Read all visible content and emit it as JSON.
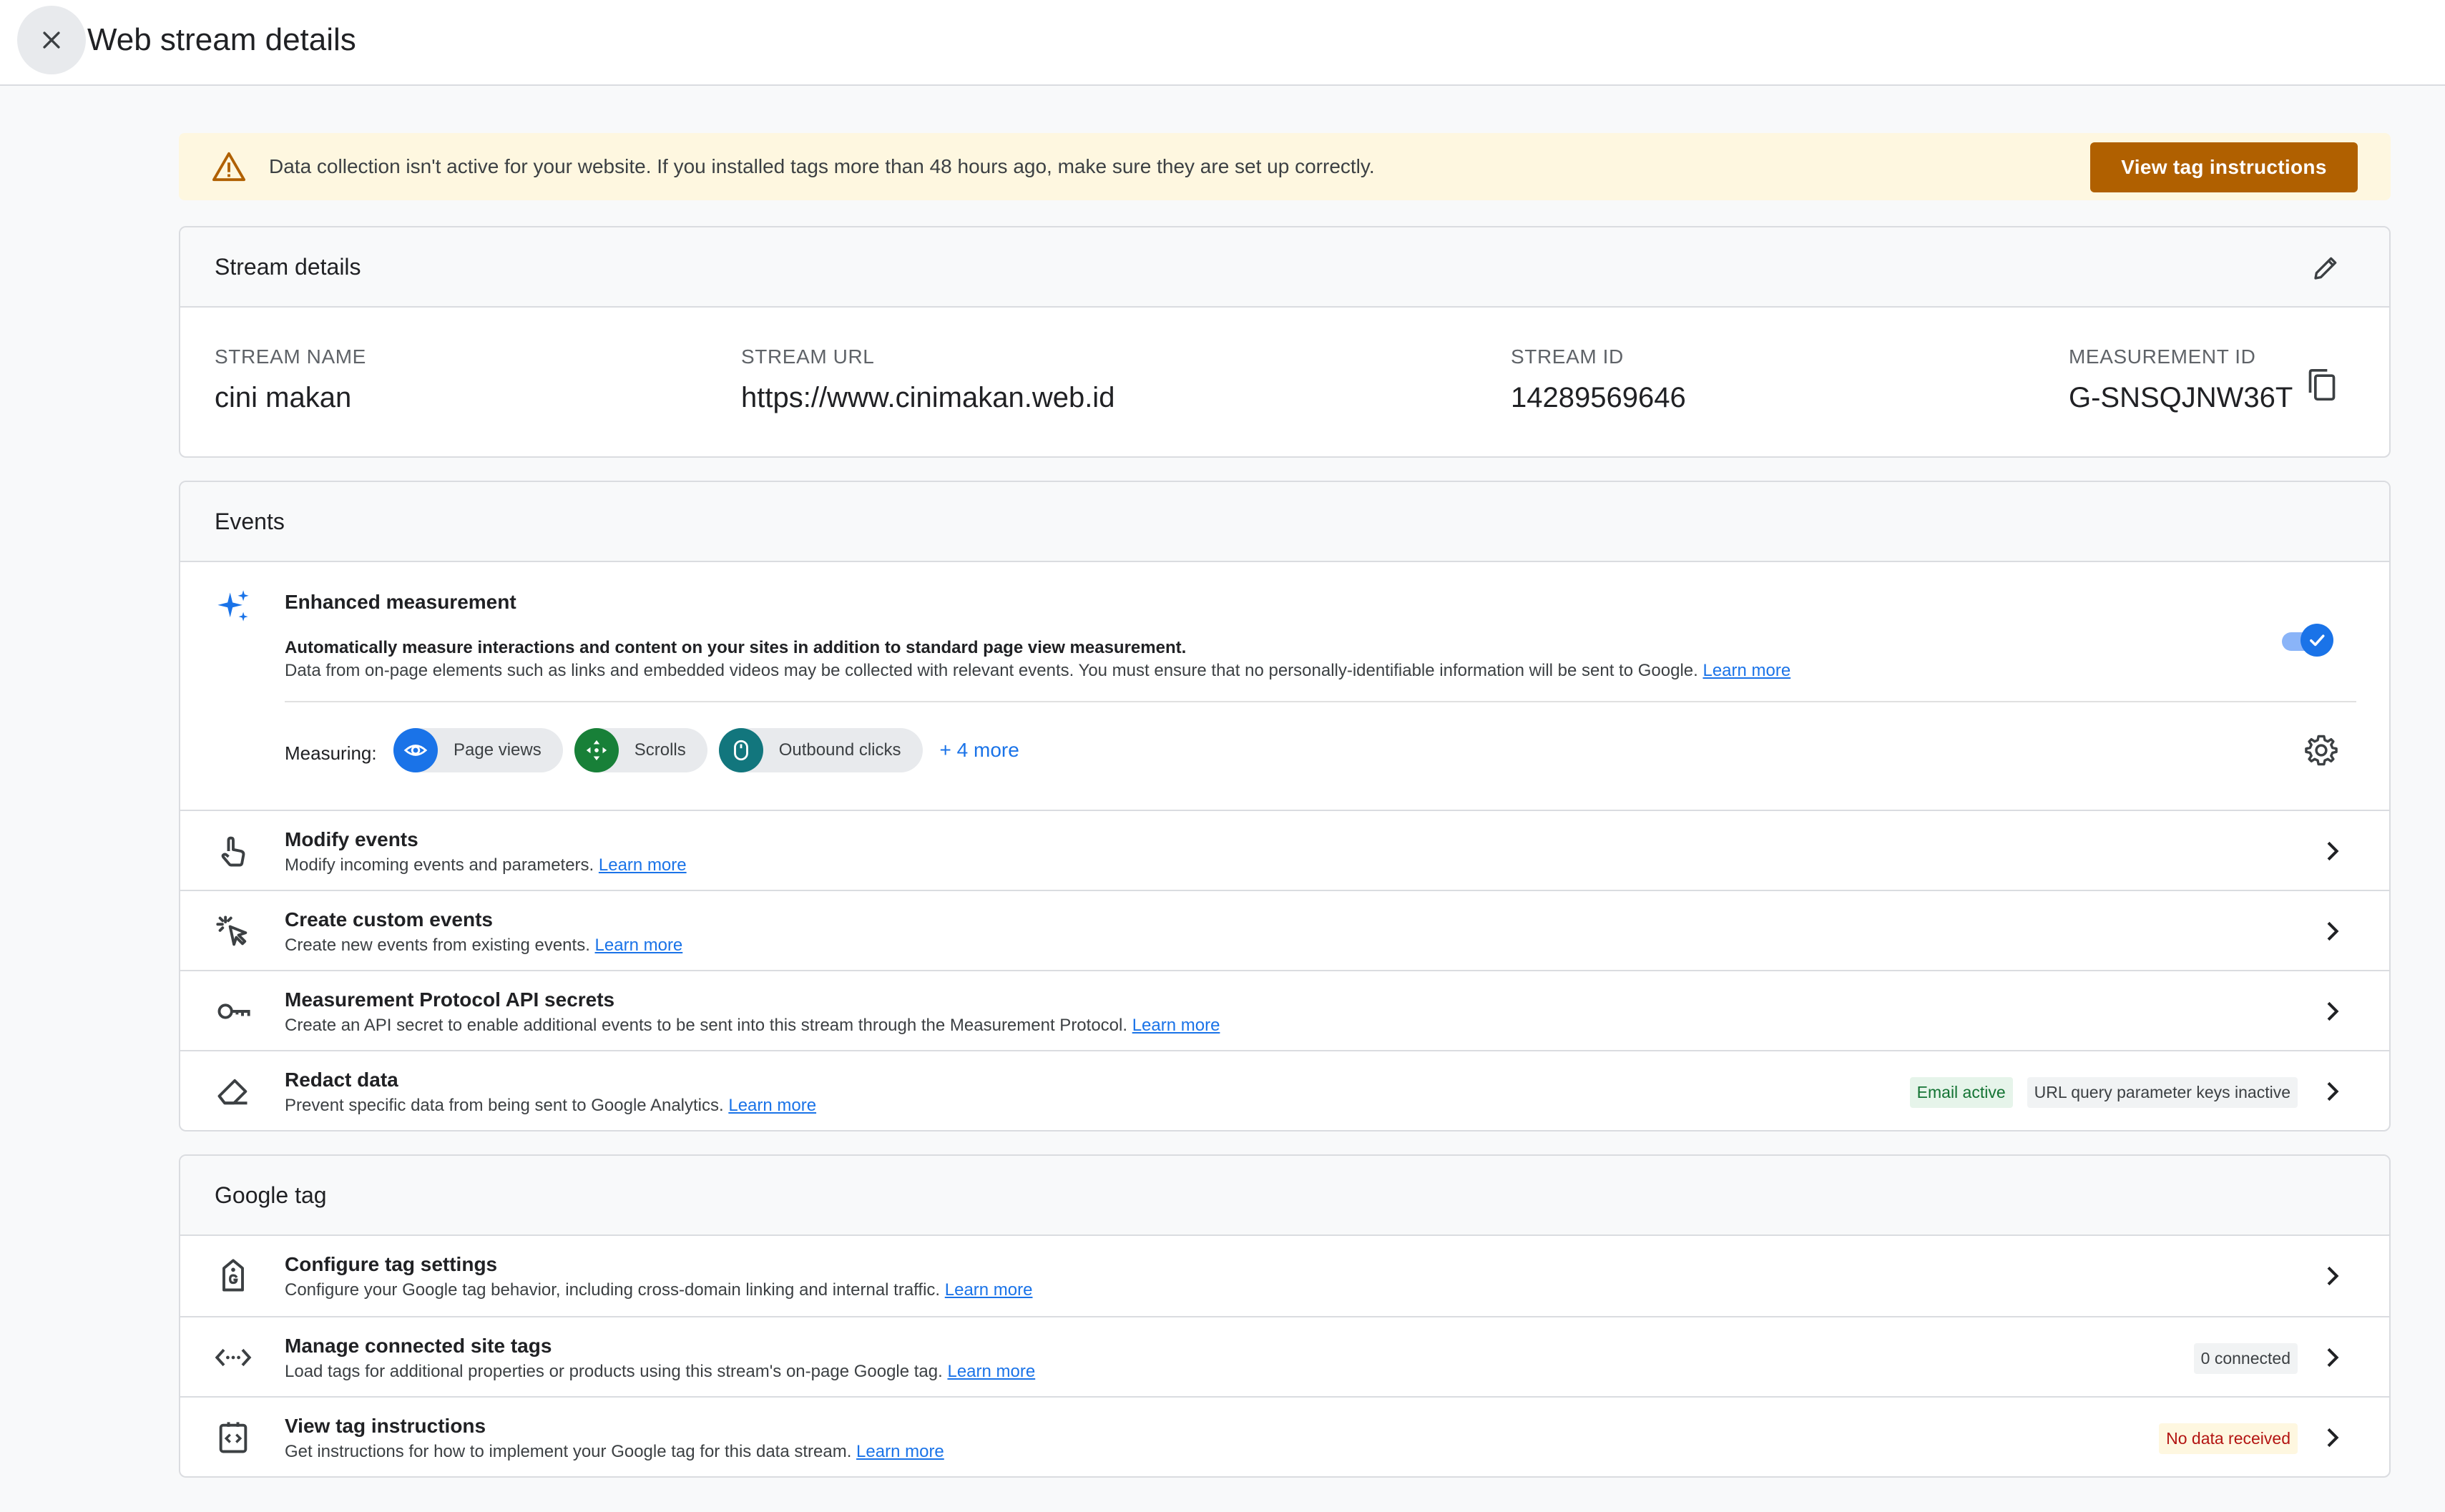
{
  "header": {
    "title": "Web stream details"
  },
  "banner": {
    "text": "Data collection isn't active for your website. If you installed tags more than 48 hours ago, make sure they are set up correctly.",
    "button_label": "View tag instructions"
  },
  "stream_details": {
    "title": "Stream details",
    "fields": [
      {
        "label": "STREAM NAME",
        "value": "cini makan"
      },
      {
        "label": "STREAM URL",
        "value": "https://www.cinimakan.web.id"
      },
      {
        "label": "STREAM ID",
        "value": "14289569646"
      },
      {
        "label": "MEASUREMENT ID",
        "value": "G-SNSQJNW36T"
      }
    ]
  },
  "events": {
    "title": "Events",
    "enhanced": {
      "title": "Enhanced measurement",
      "desc1": "Automatically measure interactions and content on your sites in addition to standard page view measurement.",
      "desc2": "Data from on-page elements such as links and embedded videos may be collected with relevant events. You must ensure that no personally-identifiable information will be sent to Google.",
      "learn_more": "Learn more",
      "enabled": true,
      "measuring_label": "Measuring:",
      "chips": [
        {
          "label": "Page views",
          "icon": "eye-icon",
          "color": "#1a73e8"
        },
        {
          "label": "Scrolls",
          "icon": "scroll-arrows-icon",
          "color": "#188038"
        },
        {
          "label": "Outbound clicks",
          "icon": "mouse-icon",
          "color": "#12767d"
        }
      ],
      "more": "+ 4 more"
    },
    "rows": [
      {
        "title": "Modify events",
        "desc": "Modify incoming events and parameters.",
        "link": "Learn more",
        "icon": "touch-hand-icon"
      },
      {
        "title": "Create custom events",
        "desc": "Create new events from existing events.",
        "link": "Learn more",
        "icon": "sparkle-click-icon"
      },
      {
        "title": "Measurement Protocol API secrets",
        "desc": "Create an API secret to enable additional events to be sent into this stream through the Measurement Protocol.",
        "link": "Learn more",
        "icon": "key-icon"
      },
      {
        "title": "Redact data",
        "desc": "Prevent specific data from being sent to Google Analytics.",
        "link": "Learn more",
        "icon": "eraser-icon",
        "badges": [
          "Email active",
          "URL query parameter keys inactive"
        ]
      }
    ]
  },
  "google_tag": {
    "title": "Google tag",
    "rows": [
      {
        "title": "Configure tag settings",
        "desc": "Configure your Google tag behavior, including cross-domain linking and internal traffic.",
        "link": "Learn more",
        "icon": "tag-icon"
      },
      {
        "title": "Manage connected site tags",
        "desc": "Load tags for additional properties or products using this stream's on-page Google tag.",
        "link": "Learn more",
        "icon": "code-arrows-icon",
        "badge": "0 connected"
      },
      {
        "title": "View tag instructions",
        "desc": "Get instructions for how to implement your Google tag for this data stream.",
        "link": "Learn more",
        "icon": "code-box-icon",
        "badge": "No data received"
      }
    ]
  },
  "colors": {
    "accent": "#1a73e8",
    "warning_button": "#b06000",
    "banner_bg": "#fef7e0"
  }
}
